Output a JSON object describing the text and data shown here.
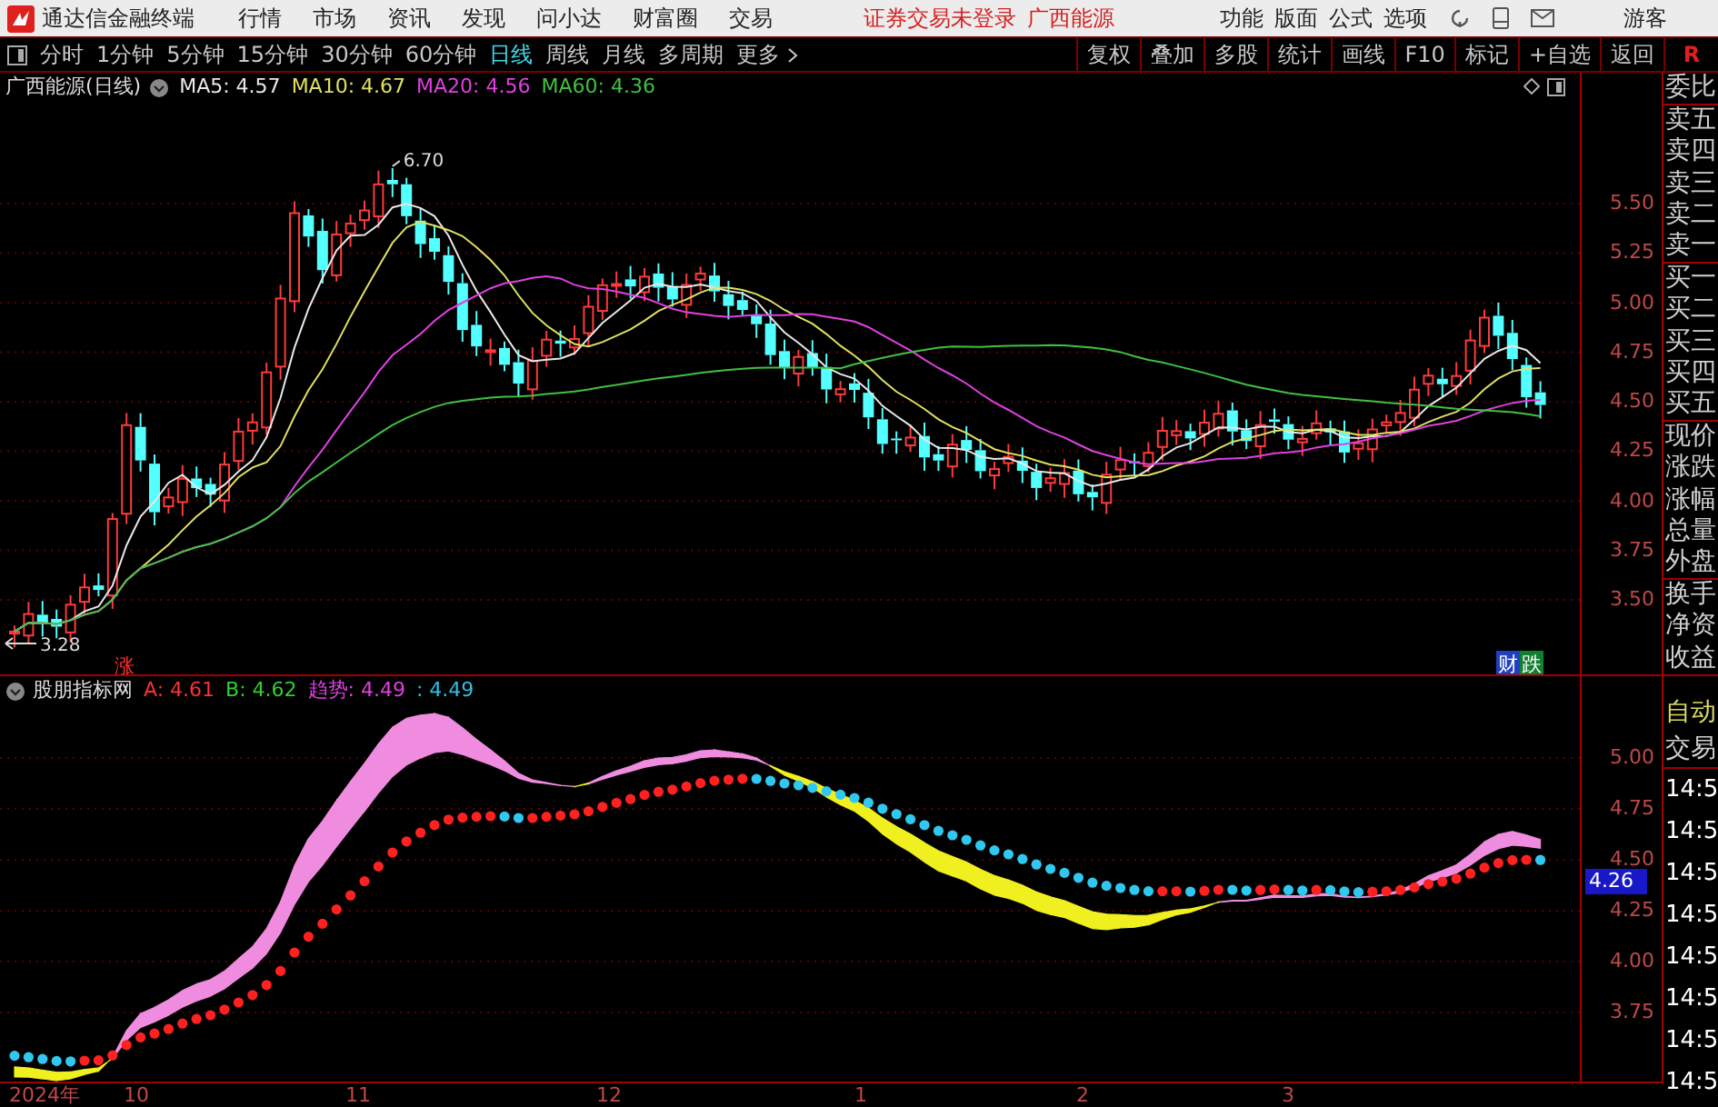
{
  "app": {
    "title": "通达信金融终端",
    "menu": [
      "行情",
      "市场",
      "资讯",
      "发现",
      "问小达",
      "财富圈",
      "交易"
    ],
    "login_status": "证券交易未登录",
    "stock_name": "广西能源",
    "right_menu": [
      "功能",
      "版面",
      "公式",
      "选项"
    ],
    "user": "游客"
  },
  "periods": [
    {
      "label": "分时",
      "selected": false
    },
    {
      "label": "1分钟",
      "selected": false
    },
    {
      "label": "5分钟",
      "selected": false
    },
    {
      "label": "15分钟",
      "selected": false
    },
    {
      "label": "30分钟",
      "selected": false
    },
    {
      "label": "60分钟",
      "selected": false
    },
    {
      "label": "日线",
      "selected": true
    },
    {
      "label": "周线",
      "selected": false
    },
    {
      "label": "月线",
      "selected": false
    },
    {
      "label": "多周期",
      "selected": false
    },
    {
      "label": "更多",
      "selected": false
    }
  ],
  "tools": [
    "复权",
    "叠加",
    "多股",
    "统计",
    "画线",
    "F10",
    "标记",
    "+自选",
    "返回"
  ],
  "tools_side": "R",
  "main_chart": {
    "title": "广西能源(日线)",
    "ma": [
      {
        "label": "MA5: 4.57",
        "color": "#e8e8e8"
      },
      {
        "label": "MA10: 4.67",
        "color": "#e0e060"
      },
      {
        "label": "MA20: 4.56",
        "color": "#e040e0"
      },
      {
        "label": "MA60: 4.36",
        "color": "#40c040"
      }
    ],
    "yticks": [
      "5.50",
      "5.25",
      "5.00",
      "4.75",
      "4.50",
      "4.25",
      "4.00",
      "3.75",
      "3.50"
    ],
    "high_label": "6.70",
    "low_label": "3.28",
    "rise_mark": "涨",
    "finance_mark": "财",
    "fall_mark": "跌"
  },
  "indicator": {
    "name": "股朋指标网",
    "values": [
      {
        "label": "A: 4.61",
        "color": "#ff3030"
      },
      {
        "label": "B: 4.62",
        "color": "#30d030"
      },
      {
        "label": "趋势: 4.49",
        "color": "#e040e0"
      },
      {
        "label": ": 4.49",
        "color": "#30c0e0"
      }
    ],
    "yticks": [
      "5.00",
      "4.75",
      "4.50",
      "4.25",
      "4.00",
      "3.75"
    ],
    "cursor_value": "4.26"
  },
  "x_axis": [
    "2024年",
    "10",
    "11",
    "12",
    "1",
    "2",
    "3"
  ],
  "quote_panel": {
    "labels": [
      "委比",
      "卖五",
      "卖四",
      "卖三",
      "卖二",
      "卖一",
      "买一",
      "买二",
      "买三",
      "买四",
      "买五",
      "现价",
      "涨跌",
      "涨幅",
      "总量",
      "外盘",
      "换手",
      "净资",
      "收益"
    ],
    "header": [
      "自动",
      "交易"
    ],
    "times": [
      "14:5",
      "14:5",
      "14:5",
      "14:5",
      "14:5",
      "14:5",
      "14:5",
      "14:5"
    ]
  }
}
